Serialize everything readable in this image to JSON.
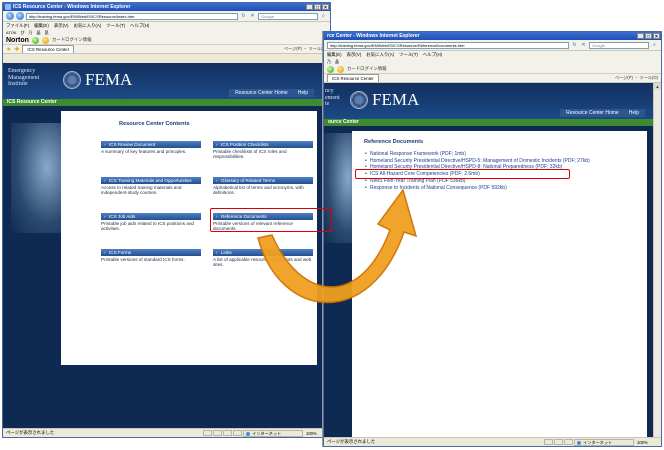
{
  "colors": {
    "highlight": "#e00000",
    "arrow_fill": "#f0a020",
    "arrow_stroke": "#d07000",
    "fema_navy": "#0e2a52",
    "resource_green": "#3d8a31"
  },
  "win1": {
    "title": "ICS Resource Center - Windows Internet Explorer",
    "url": "http://training.fema.gov/EMIWeb/IS/ICSResource/index.htm",
    "search_placeholder": "Google",
    "menu": [
      "ファイル(F)",
      "編集(E)",
      "表示(V)",
      "お気に入り(A)",
      "ツール(T)",
      "ヘルプ(H)"
    ],
    "links_row": [
      "ATOK",
      "ぴ",
      "乃",
      "晶",
      "昆"
    ],
    "norton_label": "Norton",
    "norton_card": "カードログイン情報",
    "tab_label": "ICS Resource Center",
    "tab_tools": "ページ(P) ・ ツール(O)",
    "status_text": "ページが表示されました",
    "status_zone": "インターネット",
    "status_zoom": "100%"
  },
  "win2": {
    "title": "rce Center - Windows Internet Explorer",
    "url": "http://training.fema.gov/EMIWeb/IS/ICSResource/ReferenceDocuments.htm",
    "search_placeholder": "Google",
    "menu": [
      "編集(E)",
      "表示(V)",
      "お気に入り(A)",
      "ツール(T)",
      "ヘルプ(H)"
    ],
    "links_row": [
      "乃",
      "晶"
    ],
    "norton_card": "カードログイン情報",
    "tab_label": "ICS Resource Center",
    "tab_tools": "ページ(P) ・ ツール(O)",
    "status_text": "ページが表示されました",
    "status_zone": "インターネット",
    "status_zoom": "100%"
  },
  "site": {
    "institute_lines": [
      "Emergency",
      "Management",
      "Institute"
    ],
    "institute_lines_cropped": [
      "ncy",
      "ement",
      "te"
    ],
    "agency": "FEMA",
    "nav_home": "Resource Center Home",
    "nav_help": "Help",
    "section_bar": "ICS Resource Center",
    "section_bar_cropped": "ource Center"
  },
  "contents": {
    "heading": "Resource Center Contents",
    "entries": [
      {
        "title": "ICS Review Document",
        "desc": "A summary of key features and principles."
      },
      {
        "title": "ICS Position Checklists",
        "desc": "Printable checklists of ICS roles and responsibilities."
      },
      {
        "title": "ICS Training Materials and Opportunities",
        "desc": "Access to related training materials and independent-study courses."
      },
      {
        "title": "Glossary of Related Terms",
        "desc": "Alphabetical list of terms and acronyms, with definitions."
      },
      {
        "title": "ICS Job Aids",
        "desc": "Printable job aids related to ICS positions and activities."
      },
      {
        "title": "Reference Documents",
        "desc": "Printable versions of relevant reference documents."
      },
      {
        "title": "ICS Forms",
        "desc": "Printable versions of standard ICS forms."
      },
      {
        "title": "Links",
        "desc": "A list of applicable resource documents and web sites."
      }
    ]
  },
  "reference": {
    "heading": "Reference Documents",
    "items": [
      "National Response Framework (PDF; 1mb)",
      "Homeland Security Presidential Directive/HSPD-5: Management of Domestic Incidents (PDF; 27kb)",
      "Homeland Security Presidential Directive/HSPD-8: National Preparedness (PDF; 32kb)",
      "ICS All-Hazard Core Competencies (PDF; 2.6mb)",
      "NIMS Five-Year Training Plan (PDF 536kb)",
      "Response to Incidents of National Consequence (PDF 592kb)"
    ]
  }
}
